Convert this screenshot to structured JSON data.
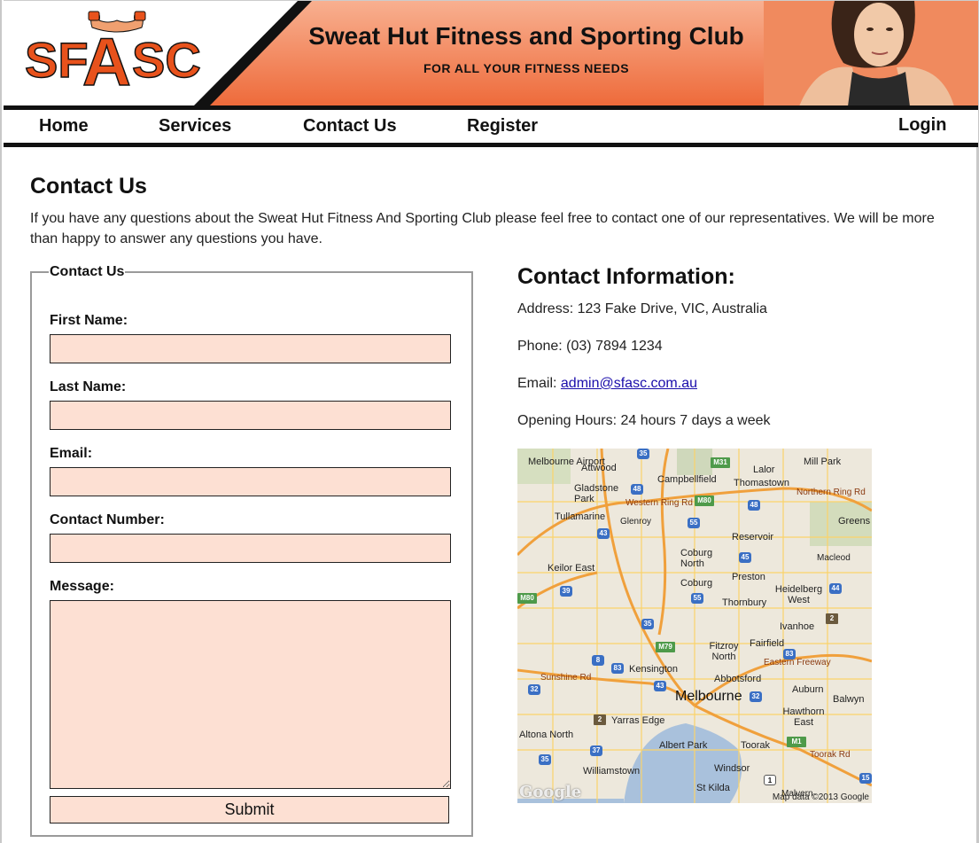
{
  "header": {
    "logo_text": "SFASC",
    "title": "Sweat Hut Fitness and Sporting Club",
    "tagline": "FOR ALL YOUR FITNESS NEEDS",
    "banner_color": "#f08050"
  },
  "nav": {
    "items": [
      {
        "label": "Home"
      },
      {
        "label": "Services"
      },
      {
        "label": "Contact Us"
      },
      {
        "label": "Register"
      }
    ],
    "login_label": "Login"
  },
  "main": {
    "heading": "Contact Us",
    "intro": "If you have any questions about the Sweat Hut Fitness And Sporting Club please feel free to contact one of our representatives. We will be more than happy to answer any questions you have."
  },
  "form": {
    "legend": "Contact Us",
    "fields": [
      {
        "label": "First Name:",
        "value": ""
      },
      {
        "label": "Last Name:",
        "value": ""
      },
      {
        "label": "Email:",
        "value": ""
      },
      {
        "label": "Contact Number:",
        "value": ""
      }
    ],
    "message_label": "Message:",
    "message_value": "",
    "submit_label": "Submit",
    "input_bg_color": "#fde0d3"
  },
  "contact_info": {
    "heading": "Contact Information:",
    "address_label": "Address:",
    "address": "123 Fake Drive, VIC, Australia",
    "phone_label": "Phone:",
    "phone": "(03) 7894 1234",
    "email_label": "Email:",
    "email": "admin@sfasc.com.au",
    "hours_label": "Opening Hours:",
    "hours": "24 hours 7 days a week"
  },
  "map": {
    "places": [
      "Melbourne Airport",
      "Attwood",
      "Campbellfield",
      "Lalor",
      "Mill Park",
      "Thomastown",
      "Gladstone Park",
      "Western Ring Rd",
      "Northern Ring Rd",
      "Tullamarine",
      "Glenroy",
      "Greens",
      "Reservoir",
      "Coburg North",
      "Macleod",
      "Keilor East",
      "Coburg",
      "Preston",
      "Heidelberg West",
      "Thornbury",
      "Ivanhoe",
      "Fitzroy North",
      "Fairfield",
      "Kensington",
      "Eastern Freeway",
      "Abbotsford",
      "Sunshine Rd",
      "Melbourne",
      "Auburn",
      "Balwyn",
      "Yarras Edge",
      "Hawthorn East",
      "Albert Park",
      "Toorak",
      "Altona North",
      "Toorak Rd",
      "Williamstown",
      "Windsor",
      "St Kilda",
      "Malvern"
    ],
    "credit": "Map data ©2013 Google",
    "brand": "Google"
  }
}
